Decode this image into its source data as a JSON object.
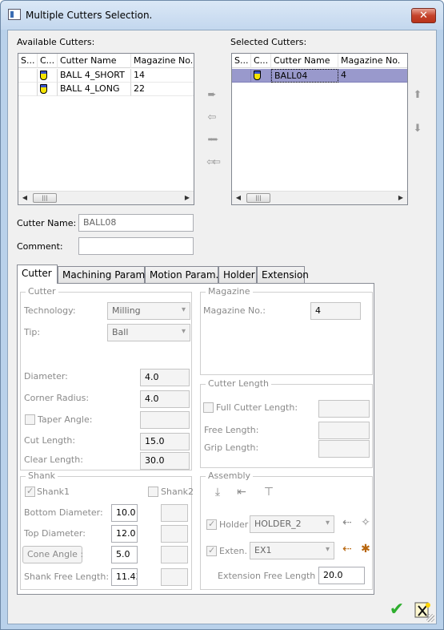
{
  "window": {
    "title": "Multiple Cutters Selection.",
    "close_glyph": "✕"
  },
  "available": {
    "label": "Available Cutters:",
    "columns": [
      "S...",
      "C...",
      "Cutter Name",
      "Magazine No."
    ],
    "rows": [
      {
        "name": "BALL 4_SHORT",
        "magazine": "14"
      },
      {
        "name": "BALL 4_LONG",
        "magazine": "22"
      }
    ]
  },
  "selected": {
    "label": "Selected Cutters:",
    "columns": [
      "S...",
      "C...",
      "Cutter Name",
      "Magazine No."
    ],
    "rows": [
      {
        "name": "BALL04",
        "magazine": "4"
      }
    ]
  },
  "transfer": {
    "move_right": "➨",
    "move_left": "⇦",
    "move_all_right": "➨➨",
    "move_all_left": "⇦⇦",
    "up": "⬆",
    "down": "⬇"
  },
  "cutter_name": {
    "label": "Cutter Name:",
    "value": "BALL08"
  },
  "comment": {
    "label": "Comment:",
    "value": ""
  },
  "tabs": [
    "Cutter",
    "Machining Param.",
    "Motion Param.",
    "Holder",
    "Extension"
  ],
  "cutter_group": {
    "title": "Cutter",
    "technology_label": "Technology:",
    "technology_value": "Milling",
    "tip_label": "Tip:",
    "tip_value": "Ball",
    "diameter_label": "Diameter:",
    "diameter_value": "4.0",
    "corner_radius_label": "Corner Radius:",
    "corner_radius_value": "4.0",
    "taper_angle_label": "Taper Angle:",
    "cut_length_label": "Cut Length:",
    "cut_length_value": "15.0",
    "clear_length_label": "Clear Length:",
    "clear_length_value": "30.0"
  },
  "magazine_group": {
    "title": "Magazine",
    "label": "Magazine No.:",
    "value": "4"
  },
  "cutter_length_group": {
    "title": "Cutter Length",
    "full_label": "Full Cutter Length:",
    "free_label": "Free Length:",
    "grip_label": "Grip Length:"
  },
  "shank_group": {
    "title": "Shank",
    "shank1_label": "Shank1",
    "shank2_label": "Shank2",
    "bottom_label": "Bottom Diameter:",
    "bottom_value": "10.0",
    "top_label": "Top Diameter:",
    "top_value": "12.0",
    "cone_label": "Cone Angle :",
    "cone_value": "5.0",
    "free_label": "Shank Free Length:",
    "free_value": "11.43"
  },
  "assembly_group": {
    "title": "Assembly",
    "holder_label": "Holder",
    "holder_value": "HOLDER_2",
    "exten_label": "Exten.",
    "exten_value": "EX1",
    "ext_free_label": "Extension Free Length",
    "ext_free_value": "20.0"
  },
  "footer": {
    "ok_glyph": "✔"
  }
}
